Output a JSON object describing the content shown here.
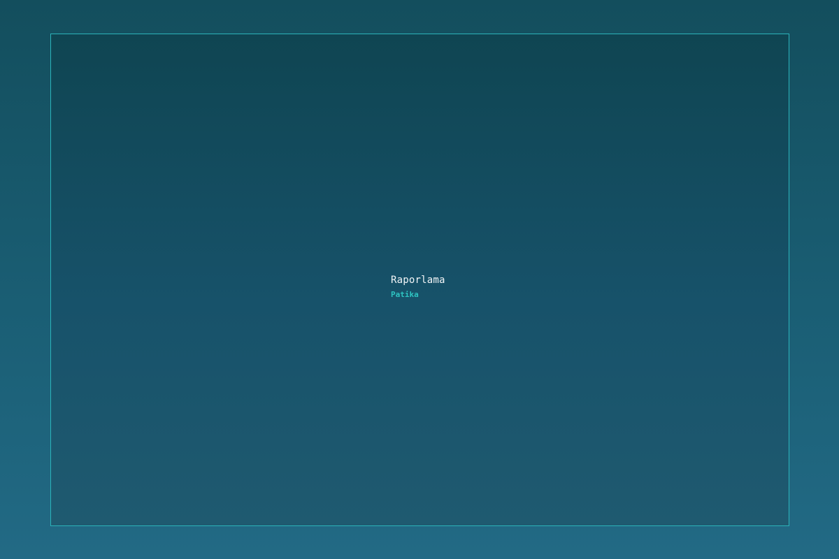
{
  "panel": {
    "title": "Raporlama",
    "subtitle": "Patika"
  },
  "colors": {
    "border": "#2bb3ba",
    "title": "#f2f5f7",
    "subtitle": "#2ec4c2",
    "background_top": "#134e5d",
    "background_bottom": "#226a85"
  }
}
